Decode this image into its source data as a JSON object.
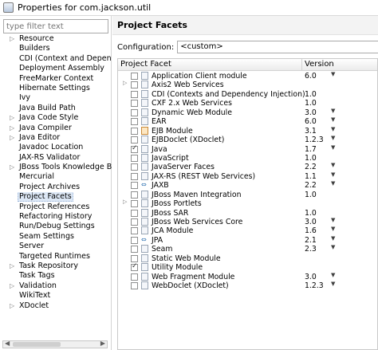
{
  "window": {
    "title": "Properties for com.jackson.util"
  },
  "nav": {
    "filter_placeholder": "type filter text",
    "items": [
      {
        "label": "Resource",
        "expandable": true
      },
      {
        "label": "Builders",
        "expandable": false
      },
      {
        "label": "CDI (Context and Depende",
        "expandable": false
      },
      {
        "label": "Deployment Assembly",
        "expandable": false
      },
      {
        "label": "FreeMarker Context",
        "expandable": false
      },
      {
        "label": "Hibernate Settings",
        "expandable": false
      },
      {
        "label": "Ivy",
        "expandable": false
      },
      {
        "label": "Java Build Path",
        "expandable": false
      },
      {
        "label": "Java Code Style",
        "expandable": true
      },
      {
        "label": "Java Compiler",
        "expandable": true
      },
      {
        "label": "Java Editor",
        "expandable": true
      },
      {
        "label": "Javadoc Location",
        "expandable": false
      },
      {
        "label": "JAX-RS Validator",
        "expandable": false
      },
      {
        "label": "JBoss Tools Knowledge Bas",
        "expandable": true
      },
      {
        "label": "Mercurial",
        "expandable": false
      },
      {
        "label": "Project Archives",
        "expandable": false
      },
      {
        "label": "Project Facets",
        "expandable": false,
        "selected": true
      },
      {
        "label": "Project References",
        "expandable": false
      },
      {
        "label": "Refactoring History",
        "expandable": false
      },
      {
        "label": "Run/Debug Settings",
        "expandable": false
      },
      {
        "label": "Seam Settings",
        "expandable": false
      },
      {
        "label": "Server",
        "expandable": false
      },
      {
        "label": "Targeted Runtimes",
        "expandable": false
      },
      {
        "label": "Task Repository",
        "expandable": true
      },
      {
        "label": "Task Tags",
        "expandable": false
      },
      {
        "label": "Validation",
        "expandable": true
      },
      {
        "label": "WikiText",
        "expandable": false
      },
      {
        "label": "XDoclet",
        "expandable": true
      }
    ]
  },
  "main": {
    "title": "Project Facets",
    "configuration_label": "Configuration:",
    "configuration_value": "<custom>",
    "columns": {
      "facet": "Project Facet",
      "version": "Version"
    },
    "facets": [
      {
        "name": "Application Client module",
        "version": "6.0",
        "dropdown": true,
        "checked": false,
        "expandable": false,
        "icon": "page"
      },
      {
        "name": "Axis2 Web Services",
        "version": "",
        "dropdown": false,
        "checked": false,
        "expandable": true,
        "icon": "page"
      },
      {
        "name": "CDI (Contexts and Dependency Injection)",
        "version": "1.0",
        "dropdown": false,
        "checked": false,
        "expandable": false,
        "icon": "page"
      },
      {
        "name": "CXF 2.x Web Services",
        "version": "1.0",
        "dropdown": false,
        "checked": false,
        "expandable": false,
        "icon": "page"
      },
      {
        "name": "Dynamic Web Module",
        "version": "3.0",
        "dropdown": true,
        "checked": false,
        "expandable": false,
        "icon": "page"
      },
      {
        "name": "EAR",
        "version": "6.0",
        "dropdown": true,
        "checked": false,
        "expandable": false,
        "icon": "page"
      },
      {
        "name": "EJB Module",
        "version": "3.1",
        "dropdown": true,
        "checked": false,
        "expandable": false,
        "icon": "gear"
      },
      {
        "name": "EJBDoclet (XDoclet)",
        "version": "1.2.3",
        "dropdown": true,
        "checked": false,
        "expandable": false,
        "icon": "page"
      },
      {
        "name": "Java",
        "version": "1.7",
        "dropdown": true,
        "checked": true,
        "expandable": false,
        "icon": "page"
      },
      {
        "name": "JavaScript",
        "version": "1.0",
        "dropdown": false,
        "checked": false,
        "expandable": false,
        "icon": "page"
      },
      {
        "name": "JavaServer Faces",
        "version": "2.2",
        "dropdown": true,
        "checked": false,
        "expandable": false,
        "icon": "page"
      },
      {
        "name": "JAX-RS (REST Web Services)",
        "version": "1.1",
        "dropdown": true,
        "checked": false,
        "expandable": false,
        "icon": "page"
      },
      {
        "name": "JAXB",
        "version": "2.2",
        "dropdown": true,
        "checked": false,
        "expandable": false,
        "icon": "arrows"
      },
      {
        "name": "JBoss Maven Integration",
        "version": "1.0",
        "dropdown": false,
        "checked": false,
        "expandable": false,
        "icon": "page"
      },
      {
        "name": "JBoss Portlets",
        "version": "",
        "dropdown": false,
        "checked": false,
        "expandable": true,
        "icon": "page"
      },
      {
        "name": "JBoss SAR",
        "version": "1.0",
        "dropdown": false,
        "checked": false,
        "expandable": false,
        "icon": "page"
      },
      {
        "name": "JBoss Web Services Core",
        "version": "3.0",
        "dropdown": true,
        "checked": false,
        "expandable": false,
        "icon": "page"
      },
      {
        "name": "JCA Module",
        "version": "1.6",
        "dropdown": true,
        "checked": false,
        "expandable": false,
        "icon": "page"
      },
      {
        "name": "JPA",
        "version": "2.1",
        "dropdown": true,
        "checked": false,
        "expandable": false,
        "icon": "arrows"
      },
      {
        "name": "Seam",
        "version": "2.3",
        "dropdown": true,
        "checked": false,
        "expandable": false,
        "icon": "page"
      },
      {
        "name": "Static Web Module",
        "version": "",
        "dropdown": false,
        "checked": false,
        "expandable": false,
        "icon": "page"
      },
      {
        "name": "Utility Module",
        "version": "",
        "dropdown": false,
        "checked": true,
        "expandable": false,
        "icon": "page"
      },
      {
        "name": "Web Fragment Module",
        "version": "3.0",
        "dropdown": true,
        "checked": false,
        "expandable": false,
        "icon": "page"
      },
      {
        "name": "WebDoclet (XDoclet)",
        "version": "1.2.3",
        "dropdown": true,
        "checked": false,
        "expandable": false,
        "icon": "page"
      }
    ]
  }
}
